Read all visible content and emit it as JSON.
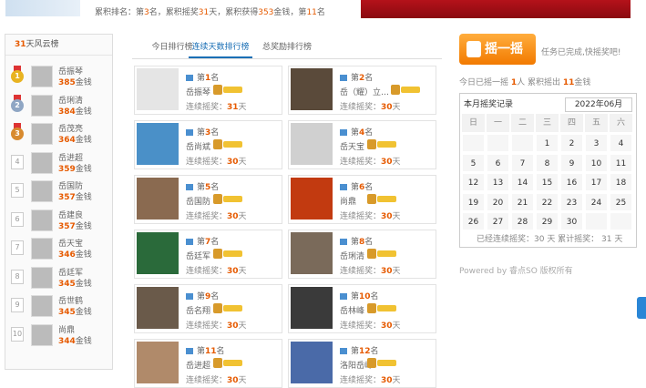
{
  "header": {
    "summary": [
      {
        "t": "累积排名：第"
      },
      {
        "t": "3",
        "h": true
      },
      {
        "t": "名，累积摇奖"
      },
      {
        "t": "31",
        "h": true
      },
      {
        "t": "天，累积获得"
      },
      {
        "t": "353",
        "h": true
      },
      {
        "t": "金钱，第"
      },
      {
        "t": "11",
        "h": true
      },
      {
        "t": "名"
      }
    ]
  },
  "left_board": {
    "title_num": "31",
    "title_text": "天风云榜",
    "items": [
      {
        "rank": "1",
        "name": "岳振琴",
        "amount": "385",
        "unit": "金钱"
      },
      {
        "rank": "2",
        "name": "岳琍清",
        "amount": "384",
        "unit": "金钱"
      },
      {
        "rank": "3",
        "name": "岳茂亮",
        "amount": "364",
        "unit": "金钱"
      },
      {
        "rank": "4",
        "name": "岳进超",
        "amount": "359",
        "unit": "金钱"
      },
      {
        "rank": "5",
        "name": "岳国防",
        "amount": "357",
        "unit": "金钱"
      },
      {
        "rank": "6",
        "name": "岳建良",
        "amount": "357",
        "unit": "金钱"
      },
      {
        "rank": "7",
        "name": "岳天宝",
        "amount": "346",
        "unit": "金钱"
      },
      {
        "rank": "8",
        "name": "岳廷军",
        "amount": "345",
        "unit": "金钱"
      },
      {
        "rank": "9",
        "name": "岳世鹤",
        "amount": "345",
        "unit": "金钱"
      },
      {
        "rank": "10",
        "name": "尚鼎",
        "amount": "344",
        "unit": "金钱"
      }
    ]
  },
  "tabs": [
    {
      "label": "今日排行榜"
    },
    {
      "label": "连续天数排行榜"
    },
    {
      "label": "总奖励排行榜"
    }
  ],
  "cards": [
    {
      "pre": "第",
      "rank": "1",
      "post": "名",
      "name": "岳振琴",
      "label": "连续摇奖：",
      "days": "31",
      "unit": "天"
    },
    {
      "pre": "第",
      "rank": "2",
      "post": "名",
      "name": "岳（耀）立…",
      "label": "连续摇奖：",
      "days": "30",
      "unit": "天"
    },
    {
      "pre": "第",
      "rank": "3",
      "post": "名",
      "name": "岳尚斌",
      "label": "连续摇奖：",
      "days": "30",
      "unit": "天"
    },
    {
      "pre": "第",
      "rank": "4",
      "post": "名",
      "name": "岳天宝",
      "label": "连续摇奖：",
      "days": "30",
      "unit": "天"
    },
    {
      "pre": "第",
      "rank": "5",
      "post": "名",
      "name": "岳国防",
      "label": "连续摇奖：",
      "days": "30",
      "unit": "天"
    },
    {
      "pre": "第",
      "rank": "6",
      "post": "名",
      "name": "尚鼎",
      "label": "连续摇奖：",
      "days": "30",
      "unit": "天"
    },
    {
      "pre": "第",
      "rank": "7",
      "post": "名",
      "name": "岳廷军",
      "label": "连续摇奖：",
      "days": "30",
      "unit": "天"
    },
    {
      "pre": "第",
      "rank": "8",
      "post": "名",
      "name": "岳琍清",
      "label": "连续摇奖：",
      "days": "30",
      "unit": "天"
    },
    {
      "pre": "第",
      "rank": "9",
      "post": "名",
      "name": "岳名翔",
      "label": "连续摇奖：",
      "days": "30",
      "unit": "天"
    },
    {
      "pre": "第",
      "rank": "10",
      "post": "名",
      "name": "岳林峰",
      "label": "连续摇奖：",
      "days": "30",
      "unit": "天"
    },
    {
      "pre": "第",
      "rank": "11",
      "post": "名",
      "name": "岳进超",
      "label": "连续摇奖：",
      "days": "30",
      "unit": "天"
    },
    {
      "pre": "第",
      "rank": "12",
      "post": "名",
      "name": "洛阳岳峰",
      "label": "连续摇奖：",
      "days": "30",
      "unit": "天"
    }
  ],
  "side": {
    "button_label": "摇一摇",
    "task_done": "任务已完成,快摇奖吧!",
    "today": [
      {
        "t": "今日已摇一摇 "
      },
      {
        "t": "1",
        "h": true
      },
      {
        "t": "人 累积摇出 "
      },
      {
        "t": "11",
        "h": true
      },
      {
        "t": "金钱"
      }
    ]
  },
  "calendar": {
    "title": "本月摇奖记录",
    "month": "2022年06月",
    "weekdays": [
      "日",
      "一",
      "二",
      "三",
      "四",
      "五",
      "六"
    ],
    "days": [
      "",
      "",
      "",
      "1",
      "2",
      "3",
      "4",
      "5",
      "6",
      "7",
      "8",
      "9",
      "10",
      "11",
      "12",
      "13",
      "14",
      "15",
      "16",
      "17",
      "18",
      "19",
      "20",
      "21",
      "22",
      "23",
      "24",
      "25",
      "26",
      "27",
      "28",
      "29",
      "30"
    ],
    "footer": "已经连续摇奖：30 天 累计摇奖： 31 天"
  },
  "footer": {
    "powered": "Powered by 睿点SO 版权所有"
  },
  "colors": {
    "accent": "#e65a00",
    "tab_active": "#1a6fb5",
    "button": "#f27a00",
    "banner": "#b4121a"
  }
}
